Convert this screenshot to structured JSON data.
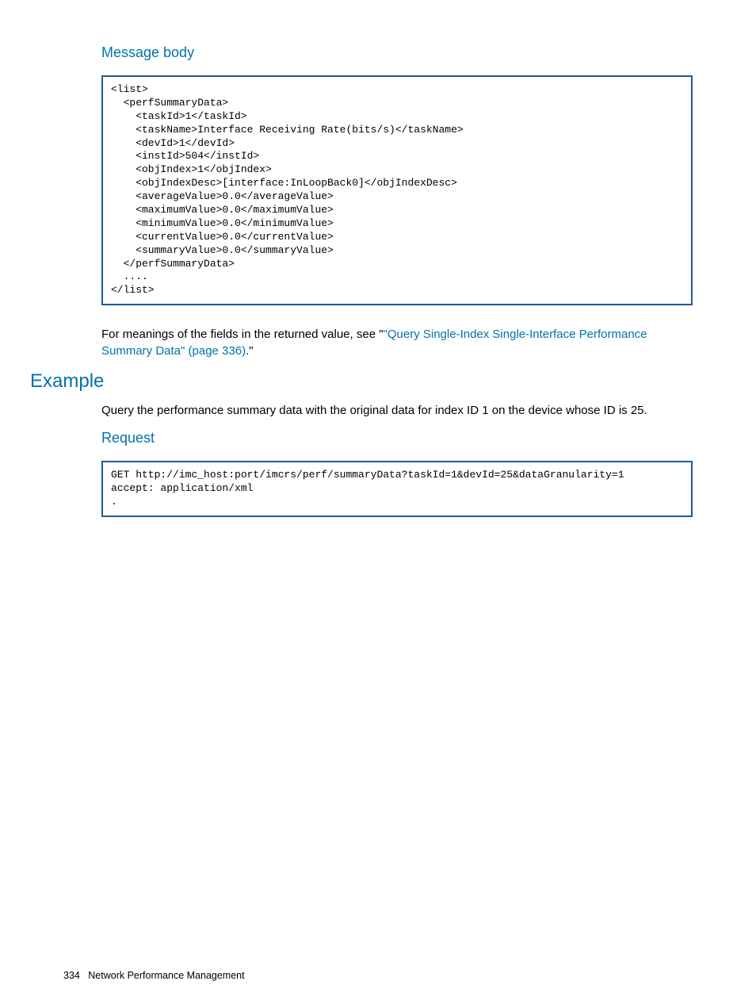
{
  "section1": {
    "title": "Message body",
    "code": "<list>\n  <perfSummaryData>\n    <taskId>1</taskId>\n    <taskName>Interface Receiving Rate(bits/s)</taskName>\n    <devId>1</devId>\n    <instId>504</instId>\n    <objIndex>1</objIndex>\n    <objIndexDesc>[interface:InLoopBack0]</objIndexDesc>\n    <averageValue>0.0</averageValue>\n    <maximumValue>0.0</maximumValue>\n    <minimumValue>0.0</minimumValue>\n    <currentValue>0.0</currentValue>\n    <summaryValue>0.0</summaryValue>\n  </perfSummaryData>\n  ....\n</list>",
    "para_pre": "For meanings of the fields in the returned value, see \"",
    "para_link": "\"Query Single-Index Single-Interface Performance Summary Data\" (page 336)",
    "para_post": ".\""
  },
  "example": {
    "title": "Example",
    "intro": "Query the performance summary data with the original data for index ID 1 on the device whose ID is 25.",
    "request_title": "Request",
    "request_code": "GET http://imc_host:port/imcrs/perf/summaryData?taskId=1&devId=25&dataGranularity=1\naccept: application/xml\n."
  },
  "footer": {
    "page": "334",
    "label": "Network Performance Management"
  }
}
